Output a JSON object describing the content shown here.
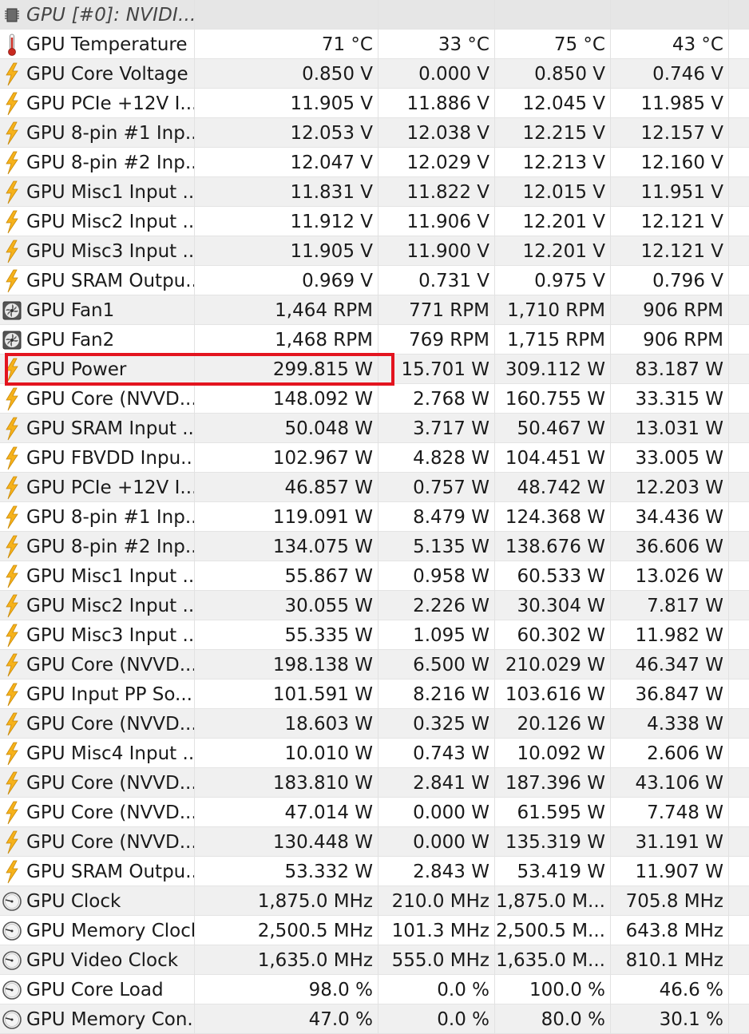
{
  "group_header": {
    "label": "GPU [#0]: NVIDI...",
    "icon": "chip-icon"
  },
  "rows": [
    {
      "icon": "thermometer-icon",
      "name": "GPU Temperature",
      "current": "71 °C",
      "min": "33 °C",
      "max": "75 °C",
      "avg": "43 °C"
    },
    {
      "icon": "lightning-icon",
      "name": "GPU Core Voltage",
      "current": "0.850 V",
      "min": "0.000 V",
      "max": "0.850 V",
      "avg": "0.746 V"
    },
    {
      "icon": "lightning-icon",
      "name": "GPU PCIe +12V I...",
      "current": "11.905 V",
      "min": "11.886 V",
      "max": "12.045 V",
      "avg": "11.985 V"
    },
    {
      "icon": "lightning-icon",
      "name": "GPU 8-pin #1 Inp...",
      "current": "12.053 V",
      "min": "12.038 V",
      "max": "12.215 V",
      "avg": "12.157 V"
    },
    {
      "icon": "lightning-icon",
      "name": "GPU 8-pin #2 Inp...",
      "current": "12.047 V",
      "min": "12.029 V",
      "max": "12.213 V",
      "avg": "12.160 V"
    },
    {
      "icon": "lightning-icon",
      "name": "GPU Misc1 Input ...",
      "current": "11.831 V",
      "min": "11.822 V",
      "max": "12.015 V",
      "avg": "11.951 V"
    },
    {
      "icon": "lightning-icon",
      "name": "GPU Misc2 Input ...",
      "current": "11.912 V",
      "min": "11.906 V",
      "max": "12.201 V",
      "avg": "12.121 V"
    },
    {
      "icon": "lightning-icon",
      "name": "GPU Misc3 Input ...",
      "current": "11.905 V",
      "min": "11.900 V",
      "max": "12.201 V",
      "avg": "12.121 V"
    },
    {
      "icon": "lightning-icon",
      "name": "GPU SRAM Outpu...",
      "current": "0.969 V",
      "min": "0.731 V",
      "max": "0.975 V",
      "avg": "0.796 V"
    },
    {
      "icon": "fan-icon",
      "name": "GPU Fan1",
      "current": "1,464 RPM",
      "min": "771 RPM",
      "max": "1,710 RPM",
      "avg": "906 RPM"
    },
    {
      "icon": "fan-icon",
      "name": "GPU Fan2",
      "current": "1,468 RPM",
      "min": "769 RPM",
      "max": "1,715 RPM",
      "avg": "906 RPM"
    },
    {
      "icon": "lightning-icon",
      "name": "GPU Power",
      "current": "299.815 W",
      "min": "15.701 W",
      "max": "309.112 W",
      "avg": "83.187 W"
    },
    {
      "icon": "lightning-icon",
      "name": "GPU Core (NVVD...",
      "current": "148.092 W",
      "min": "2.768 W",
      "max": "160.755 W",
      "avg": "33.315 W"
    },
    {
      "icon": "lightning-icon",
      "name": "GPU SRAM Input ...",
      "current": "50.048 W",
      "min": "3.717 W",
      "max": "50.467 W",
      "avg": "13.031 W"
    },
    {
      "icon": "lightning-icon",
      "name": "GPU FBVDD Inpu...",
      "current": "102.967 W",
      "min": "4.828 W",
      "max": "104.451 W",
      "avg": "33.005 W"
    },
    {
      "icon": "lightning-icon",
      "name": "GPU PCIe +12V I...",
      "current": "46.857 W",
      "min": "0.757 W",
      "max": "48.742 W",
      "avg": "12.203 W"
    },
    {
      "icon": "lightning-icon",
      "name": "GPU 8-pin #1 Inp...",
      "current": "119.091 W",
      "min": "8.479 W",
      "max": "124.368 W",
      "avg": "34.436 W"
    },
    {
      "icon": "lightning-icon",
      "name": "GPU 8-pin #2 Inp...",
      "current": "134.075 W",
      "min": "5.135 W",
      "max": "138.676 W",
      "avg": "36.606 W"
    },
    {
      "icon": "lightning-icon",
      "name": "GPU Misc1 Input ...",
      "current": "55.867 W",
      "min": "0.958 W",
      "max": "60.533 W",
      "avg": "13.026 W"
    },
    {
      "icon": "lightning-icon",
      "name": "GPU Misc2 Input ...",
      "current": "30.055 W",
      "min": "2.226 W",
      "max": "30.304 W",
      "avg": "7.817 W"
    },
    {
      "icon": "lightning-icon",
      "name": "GPU Misc3 Input ...",
      "current": "55.335 W",
      "min": "1.095 W",
      "max": "60.302 W",
      "avg": "11.982 W"
    },
    {
      "icon": "lightning-icon",
      "name": "GPU Core (NVVD...",
      "current": "198.138 W",
      "min": "6.500 W",
      "max": "210.029 W",
      "avg": "46.347 W"
    },
    {
      "icon": "lightning-icon",
      "name": "GPU Input PP So...",
      "current": "101.591 W",
      "min": "8.216 W",
      "max": "103.616 W",
      "avg": "36.847 W"
    },
    {
      "icon": "lightning-icon",
      "name": "GPU Core (NVVD...",
      "current": "18.603 W",
      "min": "0.325 W",
      "max": "20.126 W",
      "avg": "4.338 W"
    },
    {
      "icon": "lightning-icon",
      "name": "GPU Misc4 Input ...",
      "current": "10.010 W",
      "min": "0.743 W",
      "max": "10.092 W",
      "avg": "2.606 W"
    },
    {
      "icon": "lightning-icon",
      "name": "GPU Core (NVVD...",
      "current": "183.810 W",
      "min": "2.841 W",
      "max": "187.396 W",
      "avg": "43.106 W"
    },
    {
      "icon": "lightning-icon",
      "name": "GPU Core (NVVD...",
      "current": "47.014 W",
      "min": "0.000 W",
      "max": "61.595 W",
      "avg": "7.748 W"
    },
    {
      "icon": "lightning-icon",
      "name": "GPU Core (NVVD...",
      "current": "130.448 W",
      "min": "0.000 W",
      "max": "135.319 W",
      "avg": "31.191 W"
    },
    {
      "icon": "lightning-icon",
      "name": "GPU SRAM Outpu...",
      "current": "53.332 W",
      "min": "2.843 W",
      "max": "53.419 W",
      "avg": "11.907 W"
    },
    {
      "icon": "gauge-icon",
      "name": "GPU Clock",
      "current": "1,875.0 MHz",
      "min": "210.0 MHz",
      "max": "1,875.0 M...",
      "avg": "705.8 MHz"
    },
    {
      "icon": "gauge-icon",
      "name": "GPU Memory Clock",
      "current": "2,500.5 MHz",
      "min": "101.3 MHz",
      "max": "2,500.5 M...",
      "avg": "643.8 MHz"
    },
    {
      "icon": "gauge-icon",
      "name": "GPU Video Clock",
      "current": "1,635.0 MHz",
      "min": "555.0 MHz",
      "max": "1,635.0 M...",
      "avg": "810.1 MHz"
    },
    {
      "icon": "gauge-icon",
      "name": "GPU Core Load",
      "current": "98.0 %",
      "min": "0.0 %",
      "max": "100.0 %",
      "avg": "46.6 %"
    },
    {
      "icon": "gauge-icon",
      "name": "GPU Memory Con...",
      "current": "47.0 %",
      "min": "0.0 %",
      "max": "80.0 %",
      "avg": "30.1 %"
    }
  ],
  "highlighted_row": "GPU Power",
  "colors": {
    "highlight_box": "#e3141f",
    "lightning": "#f6b21b",
    "thermometer": "#c8281e",
    "row_alt": "#f0f0f0",
    "header_bg": "#e6e6e6"
  }
}
